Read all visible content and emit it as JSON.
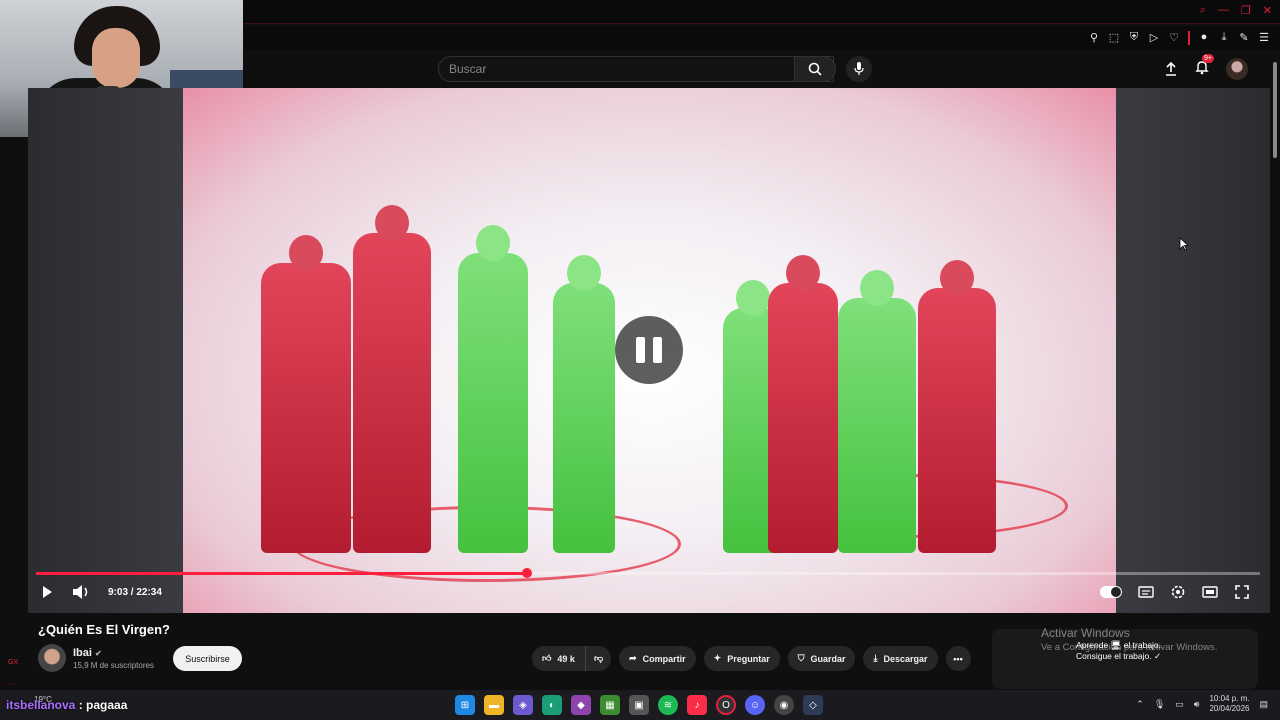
{
  "search": {
    "placeholder": "Buscar"
  },
  "header": {
    "notification_count": "9+"
  },
  "player": {
    "current_time": "9:03",
    "duration": "22:34",
    "time_display": "9:03 / 22:34",
    "progress_fraction": 0.401,
    "state": "paused"
  },
  "video": {
    "title": "¿Quién Es El Virgen?",
    "channel_name": "Ibai",
    "subscribers": "15,9 M de suscriptores",
    "subscribe_label": "Suscribirse",
    "like_count": "49 k",
    "share_label": "Compartir",
    "ask_label": "Preguntar",
    "save_label": "Guardar",
    "download_label": "Descargar"
  },
  "overlay": {
    "activate_title": "Activar Windows",
    "activate_sub": "Ve a Configuración para activar Windows.",
    "tooltip_line1": "Aprende 🖥 el trabajo.",
    "tooltip_line2": "Consigue el trabajo. ✓"
  },
  "chat": {
    "user": "itsbellanova",
    "separator": ":",
    "message": "pagaaa"
  },
  "taskbar": {
    "weather": "19°C",
    "time": "10:04 p. m.",
    "date": "20/04/2026"
  },
  "colors": {
    "accent": "#ff1e3c",
    "chrome_accent": "#e0213a",
    "bg": "#0f0f0f"
  }
}
